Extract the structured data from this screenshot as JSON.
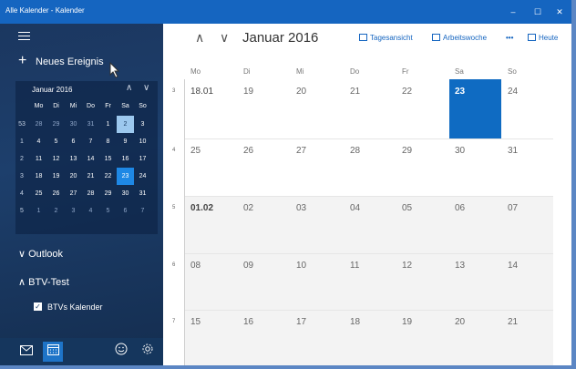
{
  "window": {
    "title": "Alle Kalender - Kalender",
    "controls": [
      "–",
      "☐",
      "✕"
    ]
  },
  "sidebar": {
    "new_event": "Neues Ereignis",
    "mini_calendar": {
      "month": "Januar 2016",
      "weekdays": [
        "Mo",
        "Di",
        "Mi",
        "Do",
        "Fr",
        "Sa",
        "So"
      ],
      "weeks": [
        {
          "num": "53",
          "days": [
            "28",
            "29",
            "30",
            "31",
            "1",
            "2",
            "3"
          ]
        },
        {
          "num": "1",
          "days": [
            "4",
            "5",
            "6",
            "7",
            "8",
            "9",
            "10"
          ]
        },
        {
          "num": "2",
          "days": [
            "11",
            "12",
            "13",
            "14",
            "15",
            "16",
            "17"
          ]
        },
        {
          "num": "3",
          "days": [
            "18",
            "19",
            "20",
            "21",
            "22",
            "23",
            "24"
          ]
        },
        {
          "num": "4",
          "days": [
            "25",
            "26",
            "27",
            "28",
            "29",
            "30",
            "31"
          ]
        },
        {
          "num": "5",
          "days": [
            "1",
            "2",
            "3",
            "4",
            "5",
            "6",
            "7"
          ]
        }
      ]
    },
    "groups": [
      {
        "label": "Outlook"
      },
      {
        "label": "BTV-Test"
      }
    ],
    "calendar_item": "BTVs Kalender"
  },
  "main": {
    "month_title": "Januar 2016",
    "toolbar": {
      "day_view": "Tagesansicht",
      "work_week": "Arbeitswoche",
      "more": "•••",
      "today": "Heute"
    },
    "weekdays": [
      "Mo",
      "Di",
      "Mi",
      "Do",
      "Fr",
      "Sa",
      "So"
    ],
    "weeks": [
      {
        "num": "3",
        "days": [
          "18.01",
          "19",
          "20",
          "21",
          "22",
          "23",
          "24"
        ]
      },
      {
        "num": "4",
        "days": [
          "25",
          "26",
          "27",
          "28",
          "29",
          "30",
          "31"
        ]
      },
      {
        "num": "5",
        "days": [
          "01.02",
          "02",
          "03",
          "04",
          "05",
          "06",
          "07"
        ]
      },
      {
        "num": "6",
        "days": [
          "08",
          "09",
          "10",
          "11",
          "12",
          "13",
          "14"
        ]
      },
      {
        "num": "7",
        "days": [
          "15",
          "16",
          "17",
          "18",
          "19",
          "20",
          "21"
        ]
      }
    ]
  },
  "colors": {
    "accent": "#1565c0",
    "selected_day": "#0f6bc2"
  }
}
